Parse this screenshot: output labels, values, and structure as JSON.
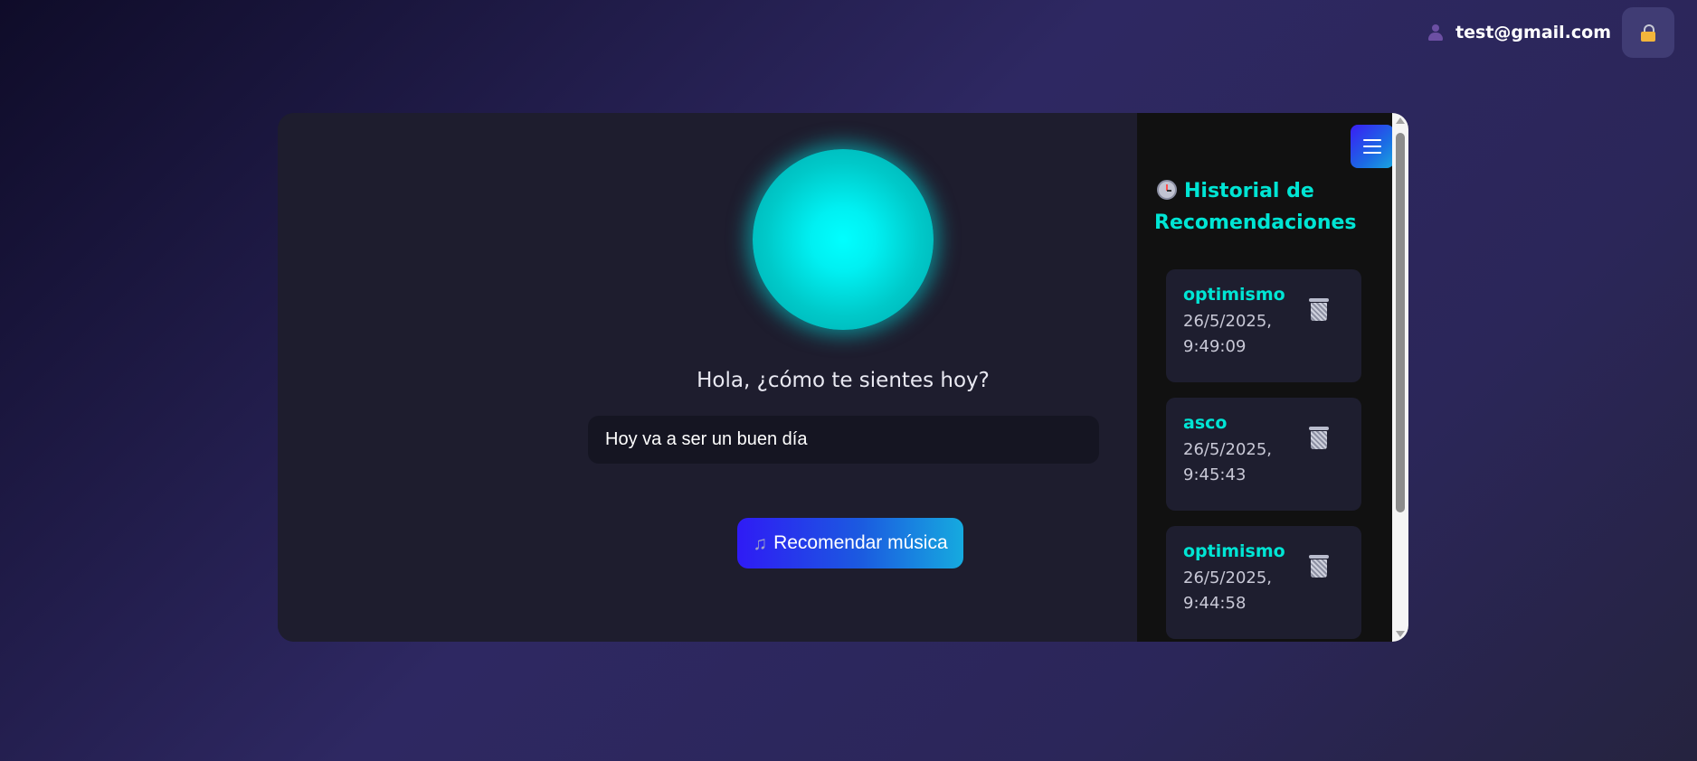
{
  "header": {
    "user_email": "test@gmail.com",
    "user_icon": "user-icon",
    "lock_icon": "lock-icon"
  },
  "main": {
    "greeting": "Hola, ¿cómo te sientes hoy?",
    "mood_input_value": "Hoy va a ser un buen día",
    "recommend_button_label": "Recomendar música",
    "recommend_button_icon": "music-note-icon",
    "orb_color": "#00ffff"
  },
  "sidebar": {
    "menu_icon": "hamburger-icon",
    "title": "Historial de Recomendaciones",
    "title_icon": "clock-icon",
    "items": [
      {
        "emotion": "optimismo",
        "date": "26/5/2025, 9:49:09"
      },
      {
        "emotion": "asco",
        "date": "26/5/2025, 9:45:43"
      },
      {
        "emotion": "optimismo",
        "date": "26/5/2025, 9:44:58"
      }
    ]
  },
  "colors": {
    "accent": "#00e5d4",
    "button_gradient_start": "#2f1bf5",
    "button_gradient_end": "#16aadf",
    "sidebar_bg": "#111111",
    "card_bg": "#1e1d2e"
  }
}
